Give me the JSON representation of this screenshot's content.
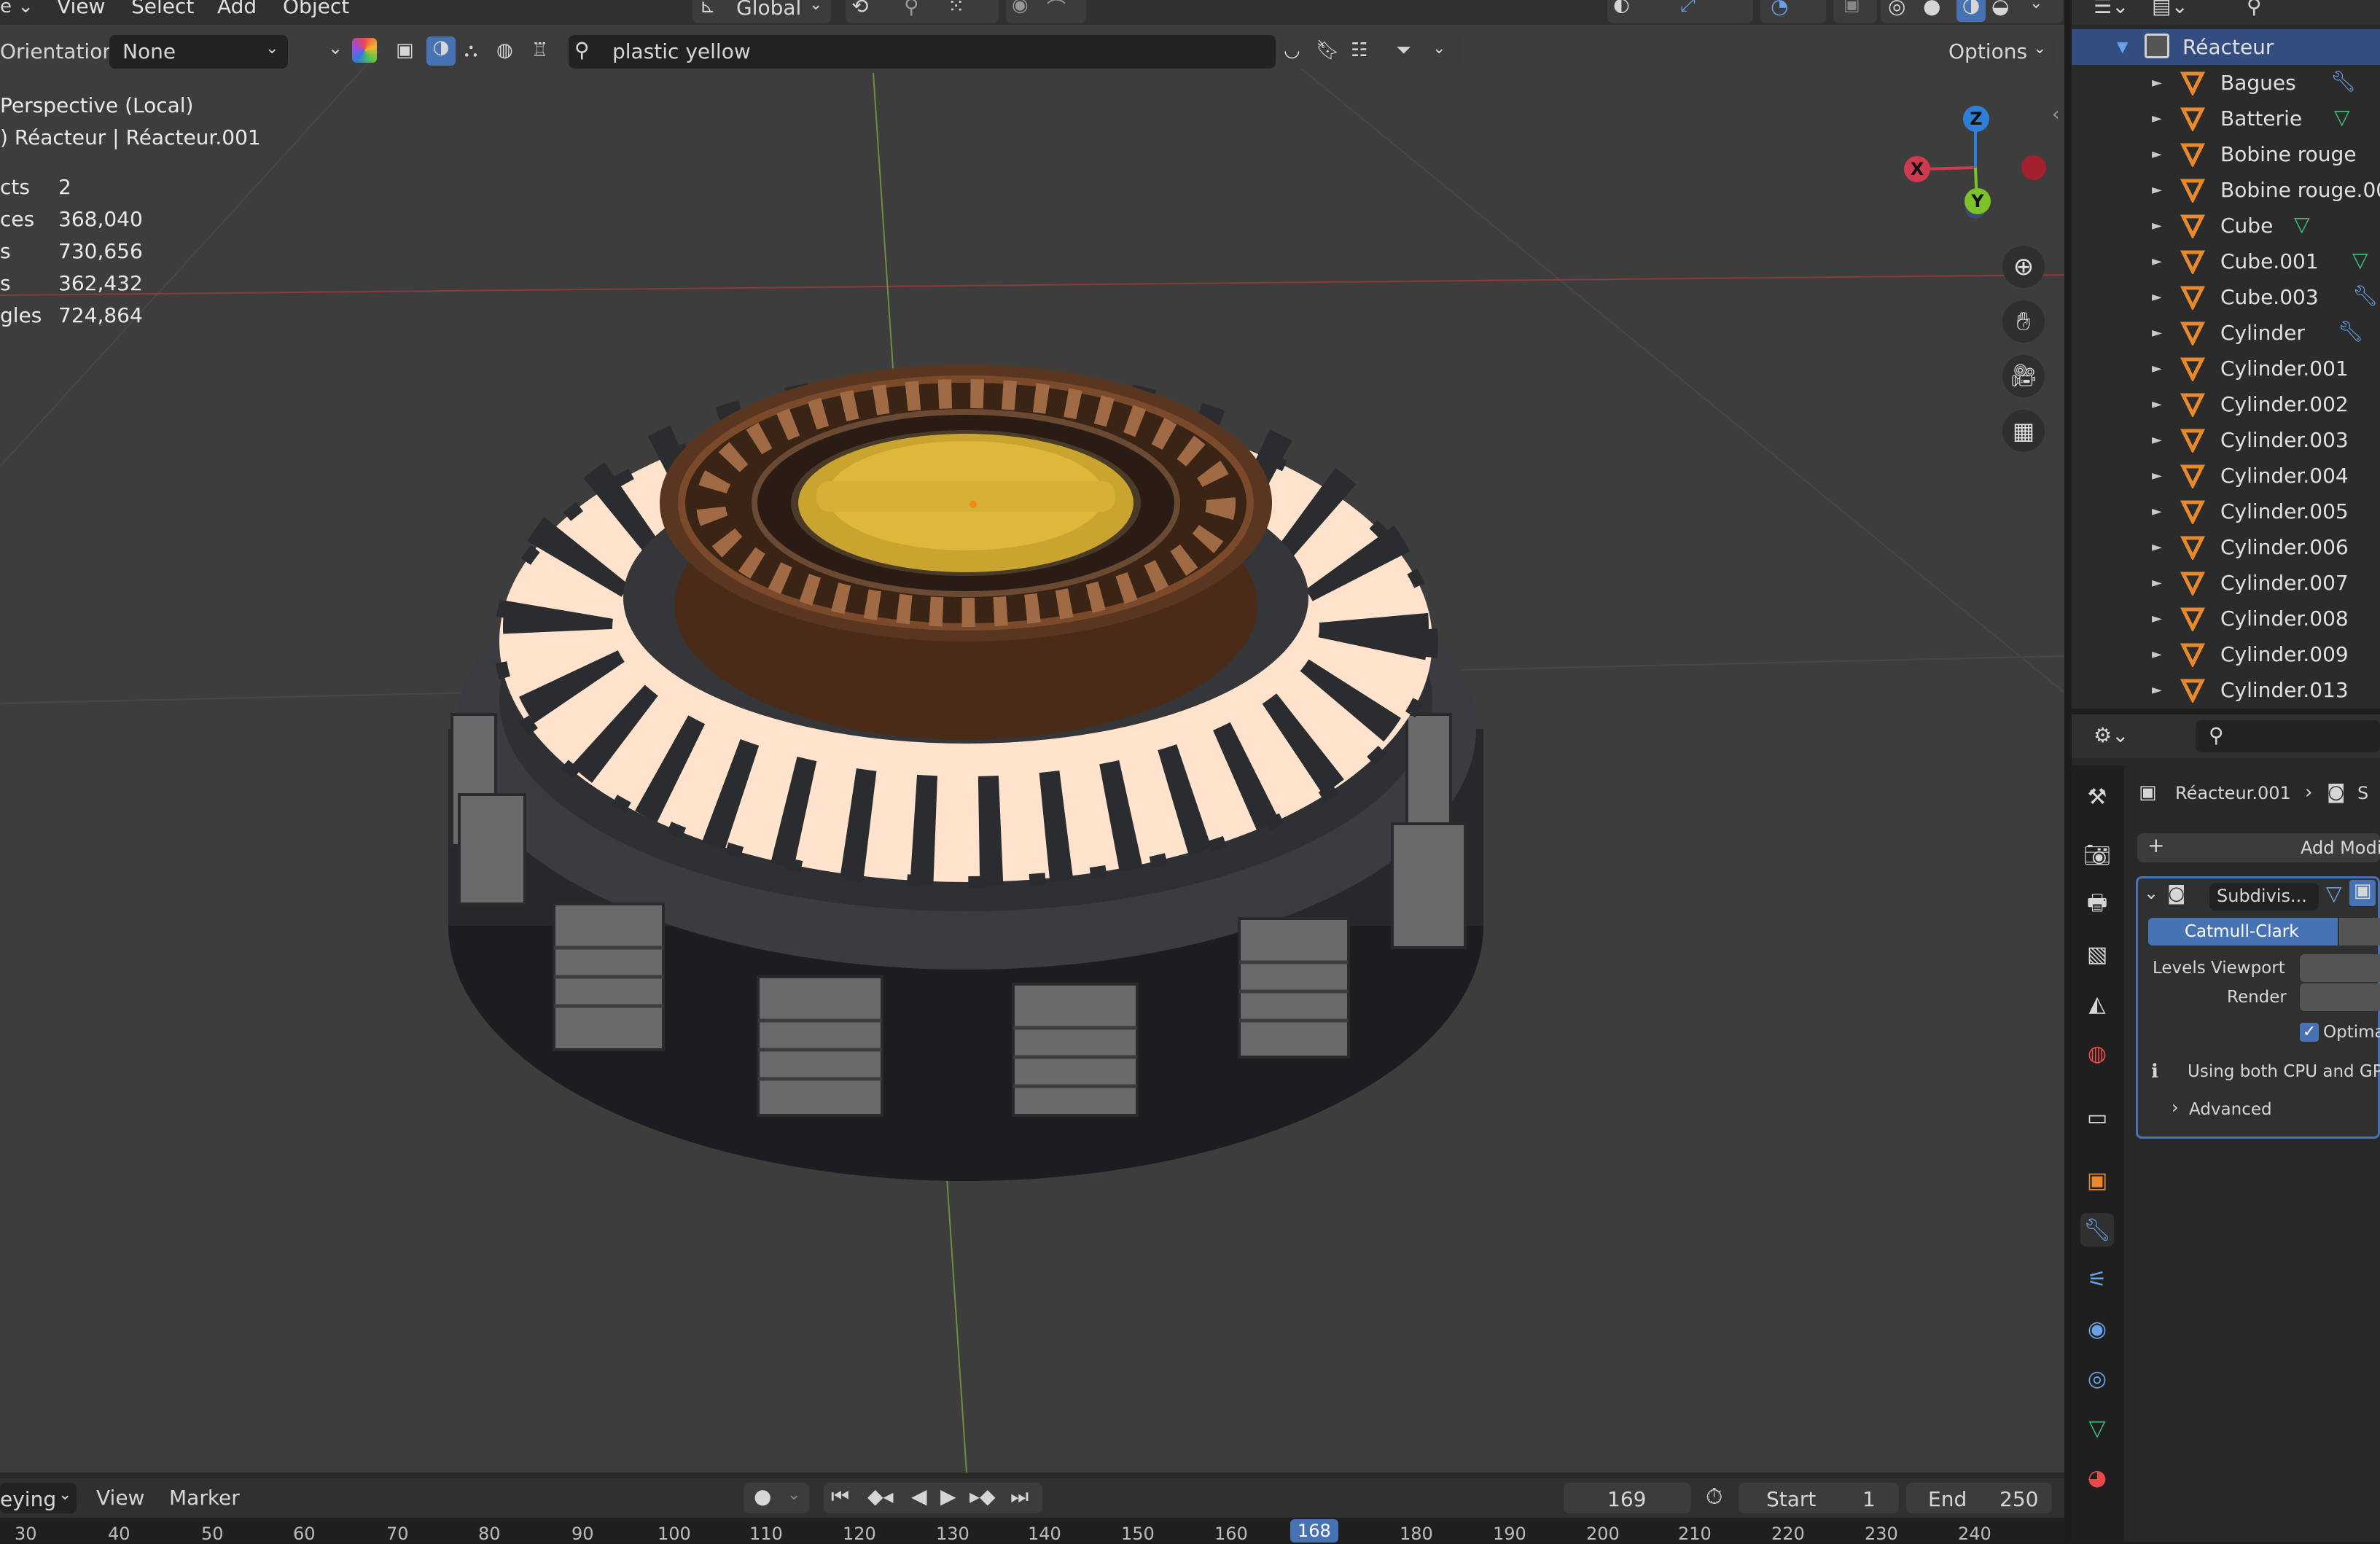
{
  "header": {
    "menu": [
      "View",
      "Select",
      "Add",
      "Object"
    ],
    "transform_orientation": "Global",
    "orientation_label": "Orientation:",
    "orientation_value": "None",
    "search_value": "plastic yellow",
    "options_label": "Options"
  },
  "viewport": {
    "view_name": "Perspective (Local)",
    "collection_line": ") Réacteur | Réacteur.001",
    "stats": [
      {
        "label": "cts",
        "value": "2"
      },
      {
        "label": "ces",
        "value": "368,040"
      },
      {
        "label": "s",
        "value": "730,656"
      },
      {
        "label": "s",
        "value": "362,432"
      },
      {
        "label": "gles",
        "value": "724,864"
      }
    ],
    "gizmo": {
      "x": "X",
      "y": "Y",
      "z": "Z"
    }
  },
  "outliner": {
    "collection": "Réacteur",
    "items": [
      "Bagues",
      "Batterie",
      "Bobine rouge",
      "Bobine rouge.00",
      "Cube",
      "Cube.001",
      "Cube.003",
      "Cylinder",
      "Cylinder.001",
      "Cylinder.002",
      "Cylinder.003",
      "Cylinder.004",
      "Cylinder.005",
      "Cylinder.006",
      "Cylinder.007",
      "Cylinder.008",
      "Cylinder.009",
      "Cylinder.013"
    ]
  },
  "properties": {
    "breadcrumb": "Réacteur.001",
    "breadcrumb_tail": "S",
    "add_modifier": "Add Modi",
    "modifier_name": "Subdivis...",
    "mode_label": "Catmull-Clark",
    "levels_viewport_label": "Levels Viewport",
    "render_label": "Render",
    "optimal_label": "Optima",
    "info_text": "Using both CPU and GP",
    "advanced_label": "Advanced"
  },
  "timeline": {
    "menu": [
      "eying",
      "View",
      "Marker"
    ],
    "current_frame": "169",
    "start_label": "Start",
    "start_value": "1",
    "end_label": "End",
    "end_value": "250",
    "ruler": [
      "30",
      "40",
      "50",
      "60",
      "70",
      "80",
      "90",
      "100",
      "110",
      "120",
      "130",
      "140",
      "150",
      "160",
      "168",
      "180",
      "190",
      "200",
      "210",
      "220",
      "230",
      "240"
    ]
  },
  "colors": {
    "accent": "#4772b3",
    "object_orange": "#e8892d",
    "axis_x": "#ce3a4e",
    "axis_y": "#7dc229",
    "axis_z": "#2e7fd8"
  }
}
